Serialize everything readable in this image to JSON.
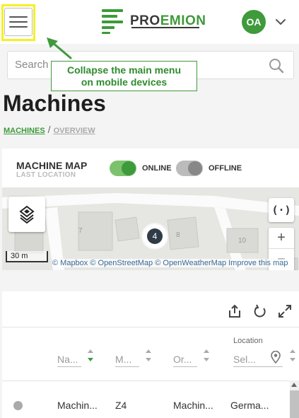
{
  "header": {
    "logo_pro": "PRO",
    "logo_emion": "EMION",
    "avatar_initials": "OA"
  },
  "search": {
    "placeholder": "Search"
  },
  "tooltip": {
    "line1": "Collapse the main menu",
    "line2": "on mobile devices"
  },
  "page": {
    "title": "Machines",
    "breadcrumb": [
      "MACHINES",
      "/",
      "OVERVIEW"
    ]
  },
  "map_card": {
    "title": "MACHINE MAP",
    "subtitle": "LAST LOCATION",
    "toggle_online_label": "ONLINE",
    "toggle_online_on": true,
    "toggle_offline_label": "OFFLINE",
    "toggle_offline_on": true,
    "cluster_count": "4",
    "locate_label": "(·)",
    "zoom_in": "+",
    "zoom_out": "−",
    "scale_label": "30 m",
    "map_numbers": [
      "7",
      "8",
      "10"
    ],
    "attribution": "© Mapbox © OpenStreetMap © OpenWeatherMap Improve this map"
  },
  "table": {
    "location_label": "Location",
    "columns": [
      "Na...",
      "M...",
      "Or...",
      "Sel..."
    ],
    "rows": [
      {
        "status": "offline",
        "name": "Machin...",
        "model": "Z4",
        "org": "Machin...",
        "location": "Germa..."
      }
    ]
  },
  "colors": {
    "brand_green": "#3e9a3a",
    "highlight_yellow": "#f5f023"
  }
}
